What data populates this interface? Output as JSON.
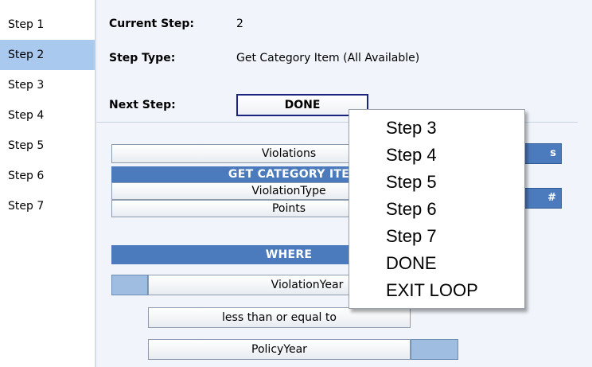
{
  "sidebar": {
    "items": [
      {
        "label": "Step 1"
      },
      {
        "label": "Step 2"
      },
      {
        "label": "Step 3"
      },
      {
        "label": "Step 4"
      },
      {
        "label": "Step 5"
      },
      {
        "label": "Step 6"
      },
      {
        "label": "Step 7"
      }
    ],
    "active_index": 1
  },
  "header": {
    "current_step_label": "Current Step:",
    "current_step_value": "2",
    "step_type_label": "Step Type:",
    "step_type_value": "Get Category Item (All Available)",
    "next_step_label": "Next Step:",
    "next_step_value": "DONE"
  },
  "builder": {
    "violations": "Violations",
    "get_category_header": "GET CATEGORY ITE",
    "violation_type": "ViolationType",
    "points": "Points",
    "where_header": "WHERE",
    "violation_year": "ViolationYear",
    "operator": "less than or equal to",
    "policy_year": "PolicyYear",
    "stub_top_text": "s",
    "stub_mid_text": "#"
  },
  "dropdown": {
    "options": [
      "Step 3",
      "Step 4",
      "Step 5",
      "Step 6",
      "Step 7",
      "DONE",
      "EXIT LOOP"
    ]
  },
  "colors": {
    "accent": "#4b7bbd",
    "selected": "#a9c9ef",
    "panel": "#f1f5fb",
    "border": "#1a237e"
  }
}
